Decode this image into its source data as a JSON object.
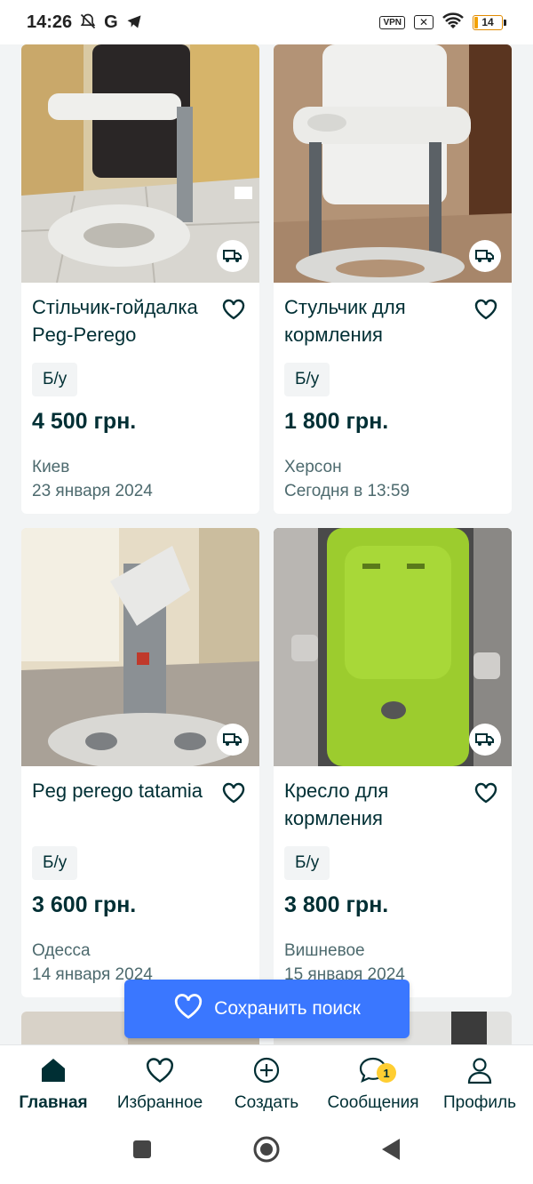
{
  "status_bar": {
    "time": "14:26",
    "g_label": "G",
    "vpn_label": "VPN",
    "x_label": "✕",
    "battery_level": "14",
    "battery_fraction": 0.14
  },
  "listings": [
    {
      "title": "Стільчик-гойдалка Peg-Perego",
      "condition": "Б/у",
      "price": "4 500 грн.",
      "city": "Киев",
      "date": "23 января 2024"
    },
    {
      "title": "Стульчик для кормления",
      "condition": "Б/у",
      "price": "1 800 грн.",
      "city": "Херсон",
      "date": "Сегодня в 13:59"
    },
    {
      "title": "Peg perego tatamia",
      "condition": "Б/у",
      "price": "3 600 грн.",
      "city": "Одесса",
      "date": "14 января 2024"
    },
    {
      "title": "Кресло для кормления",
      "condition": "Б/у",
      "price": "3 800 грн.",
      "city": "Вишневое",
      "date": "15 января 2024"
    }
  ],
  "save_search": {
    "label": "Сохранить поиск"
  },
  "bottom_nav": {
    "items": [
      {
        "label": "Главная",
        "icon": "home-icon"
      },
      {
        "label": "Избранное",
        "icon": "heart-icon"
      },
      {
        "label": "Создать",
        "icon": "plus-circle-icon"
      },
      {
        "label": "Сообщения",
        "icon": "chat-icon",
        "badge": "1"
      },
      {
        "label": "Профиль",
        "icon": "profile-icon"
      }
    ]
  },
  "colors": {
    "primary_text": "#002f34",
    "accent_blue": "#3a77ff",
    "badge_yellow": "#ffce32",
    "background": "#f2f4f5"
  }
}
